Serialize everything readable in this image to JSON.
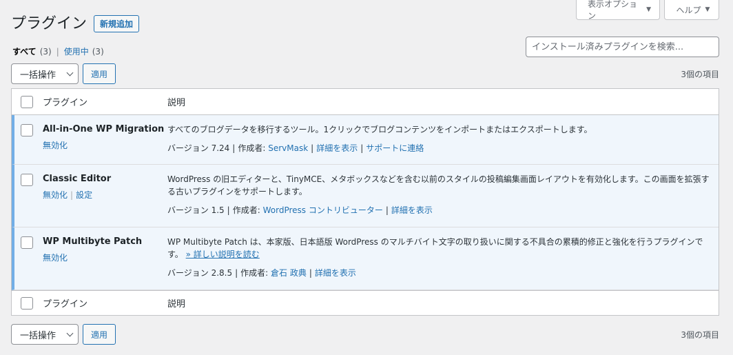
{
  "screen_meta": {
    "options_label": "表示オプション",
    "help_label": "ヘルプ"
  },
  "header": {
    "title": "プラグイン",
    "add_new_label": "新規追加"
  },
  "filters": {
    "all_label": "すべて",
    "all_count": "(3)",
    "active_label": "使用中",
    "active_count": "(3)"
  },
  "search": {
    "placeholder": "インストール済みプラグインを検索..."
  },
  "tablenav": {
    "bulk_label": "一括操作",
    "apply_label": "適用",
    "items_count": "3個の項目"
  },
  "table": {
    "col_plugin": "プラグイン",
    "col_description": "説明",
    "rows": [
      {
        "name": "All-in-One WP Migration",
        "actions": [
          "無効化"
        ],
        "description": "すべてのブログデータを移行するツール。1クリックでブログコンテンツをインポートまたはエクスポートします。",
        "version": "バージョン 7.24",
        "author_prefix": "作成者:",
        "author": "ServMask",
        "links": [
          "詳細を表示",
          "サポートに連絡"
        ]
      },
      {
        "name": "Classic Editor",
        "actions": [
          "無効化",
          "設定"
        ],
        "description": "WordPress の旧エディターと、TinyMCE、メタボックスなどを含む以前のスタイルの投稿編集画面レイアウトを有効化します。この画面を拡張する古いプラグインをサポートします。",
        "version": "バージョン 1.5",
        "author_prefix": "作成者:",
        "author": "WordPress コントリビューター",
        "links": [
          "詳細を表示"
        ]
      },
      {
        "name": "WP Multibyte Patch",
        "actions": [
          "無効化"
        ],
        "description": "WP Multibyte Patch は、本家版、日本語版 WordPress のマルチバイト文字の取り扱いに関する不具合の累積的修正と強化を行うプラグインです。",
        "description_link": "» 詳しい説明を読む",
        "version": "バージョン 2.8.5",
        "author_prefix": "作成者:",
        "author": "倉石 政典",
        "links": [
          "詳細を表示"
        ]
      }
    ]
  },
  "colors": {
    "accent": "#2271b1",
    "active_border": "#72aee6",
    "active_bg": "#f0f6fc"
  }
}
